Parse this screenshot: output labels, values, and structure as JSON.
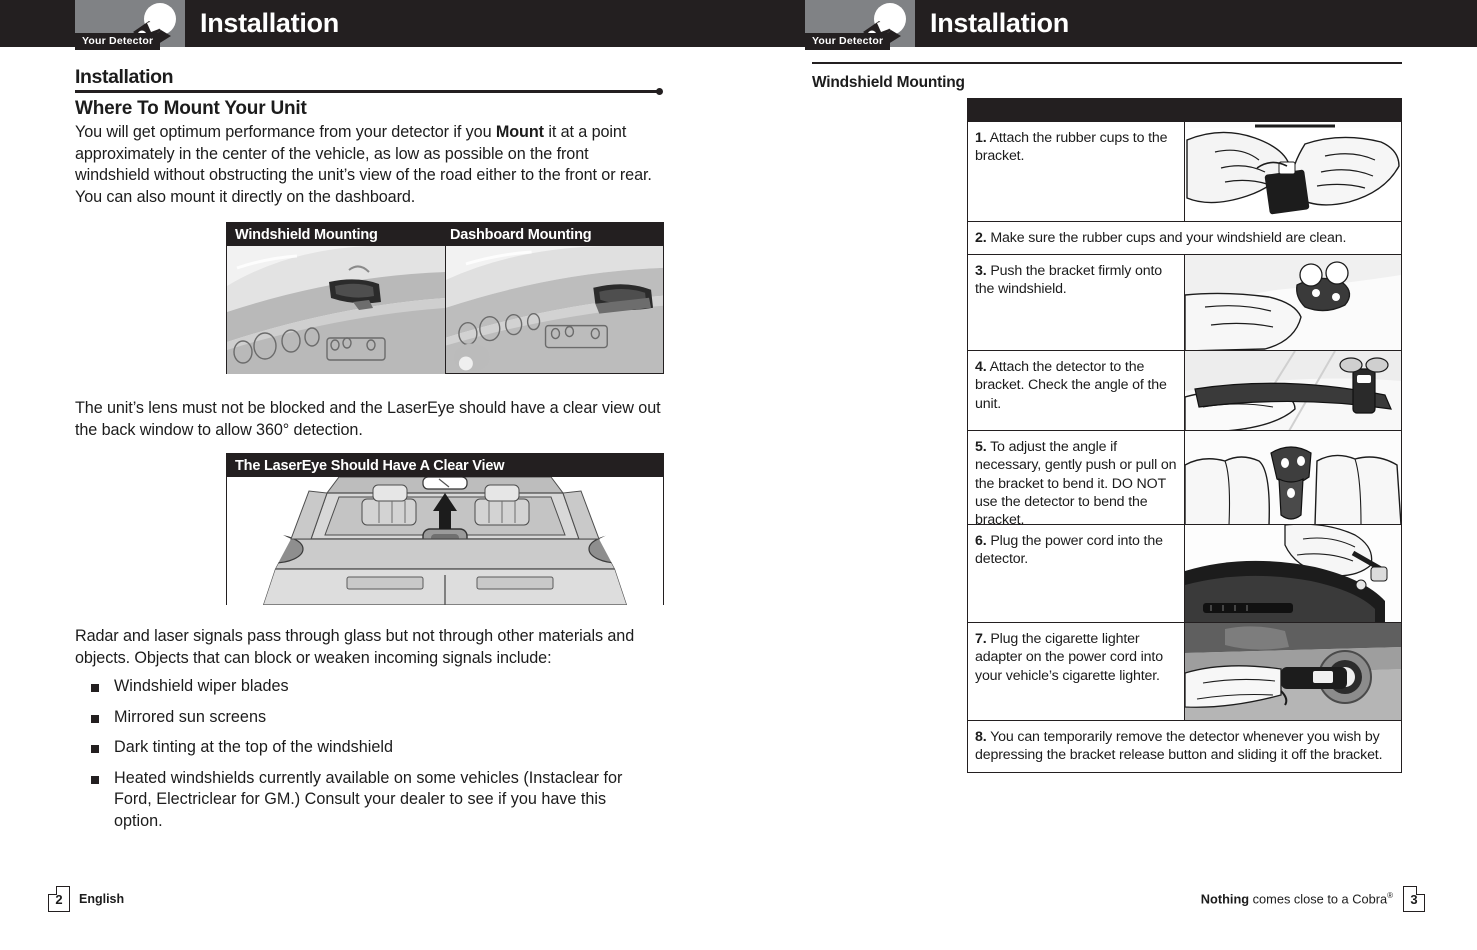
{
  "header": {
    "tab_label": "Your Detector",
    "title_left": "Installation",
    "title_right": "Installation",
    "icon_name": "radar-detector-icon",
    "bar_color": "#231f20",
    "box_color": "#808285"
  },
  "left_page": {
    "section_heading": "Installation",
    "sub_heading": "Where To Mount Your Unit",
    "paragraph_1_a": "You will get optimum performance from your detector if you ",
    "paragraph_1_bold": "Mount",
    "paragraph_1_b": " it at a point approximately in the center of the vehicle, as low as possible on the front windshield without obstructing the unit’s view of the road either to the front or rear. You can also mount it directly on the dashboard.",
    "figure_mounting": {
      "caption_left": "Windshield Mounting",
      "caption_right": "Dashboard Mounting"
    },
    "paragraph_2": "The unit’s lens must not be blocked and the LaserEye should have a clear view out the back window to allow 360° detection.",
    "figure_laser": {
      "caption": "The LaserEye Should Have A Clear View"
    },
    "paragraph_3": "Radar and laser signals pass through glass but not through other materials and objects. Objects that can block or weaken incoming signals include:",
    "bullets": [
      "Windshield wiper blades",
      "Mirrored sun screens",
      "Dark tinting at the top of the windshield",
      "Heated windshields currently available on some vehicles (Instaclear for Ford, Electriclear for GM.) Consult your dealer to see if you have this option."
    ],
    "footer": {
      "page_number": "2",
      "language": "English"
    }
  },
  "right_page": {
    "sub_heading": "Windshield Mounting",
    "steps": [
      {
        "number": "1.",
        "text": "Attach the rubber cups to the bracket.",
        "has_image": true,
        "image_name": "hands-attaching-rubber-cups-photo"
      },
      {
        "number": "2.",
        "text": "Make sure the rubber cups and your windshield are clean.",
        "has_image": false,
        "image_name": ""
      },
      {
        "number": "3.",
        "text": "Push the bracket firmly onto the windshield.",
        "has_image": true,
        "image_name": "hand-pushing-bracket-photo"
      },
      {
        "number": "4.",
        "text": "Attach the detector to the bracket. Check the angle of the unit.",
        "has_image": true,
        "image_name": "detector-on-bracket-photo"
      },
      {
        "number": "5.",
        "text": "To adjust the angle if necessary, gently push or pull on the bracket to bend it. DO NOT use the detector to bend the bracket.",
        "has_image": true,
        "image_name": "hands-bending-bracket-photo"
      },
      {
        "number": "6.",
        "text": "Plug the power cord into the detector.",
        "has_image": true,
        "image_name": "power-cord-into-detector-photo"
      },
      {
        "number": "7.",
        "text": "Plug the cigarette lighter adapter on the power cord into your vehicle’s cigarette lighter.",
        "has_image": true,
        "image_name": "cigarette-lighter-adapter-photo"
      },
      {
        "number": "8.",
        "text": "You can temporarily remove the detector whenever you wish by depressing the bracket release button and sliding it off the bracket.",
        "has_image": false,
        "image_name": ""
      }
    ],
    "footer": {
      "page_number": "3",
      "tagline_bold": "Nothing",
      "tagline_rest": " comes close to a Cobra",
      "tagline_mark": "®"
    }
  }
}
